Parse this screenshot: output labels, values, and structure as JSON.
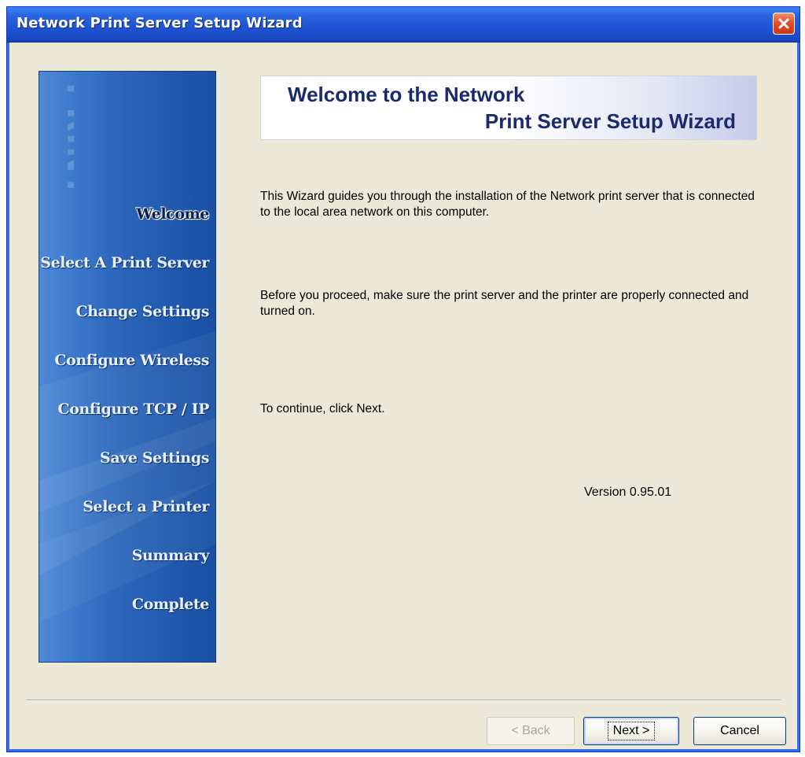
{
  "window": {
    "title": "Network Print Server Setup Wizard"
  },
  "sidebar": {
    "watermark_text": "PRINT",
    "steps": [
      {
        "label": "Welcome",
        "active": true
      },
      {
        "label": "Select A Print Server",
        "active": false
      },
      {
        "label": "Change Settings",
        "active": false
      },
      {
        "label": "Configure Wireless",
        "active": false
      },
      {
        "label": "Configure TCP / IP",
        "active": false
      },
      {
        "label": "Save Settings",
        "active": false
      },
      {
        "label": "Select a Printer",
        "active": false
      },
      {
        "label": "Summary",
        "active": false
      },
      {
        "label": "Complete",
        "active": false
      }
    ]
  },
  "banner": {
    "line1": "Welcome to the Network",
    "line2": "Print Server Setup Wizard"
  },
  "body": {
    "para1": "This Wizard guides you through the installation of the Network print server that is connected to the local area network on this computer.",
    "para2": "Before you proceed, make sure the print server and the printer are properly connected and turned on.",
    "para3": "To continue, click Next.",
    "version": "Version 0.95.01"
  },
  "buttons": {
    "back_label": "< Back",
    "next_label": "Next >",
    "cancel_label": "Cancel"
  },
  "colors": {
    "titlebar": "#1f55d4",
    "sidebar": "#2565c0",
    "banner_text": "#1a2a6c",
    "window_bg": "#ece9d8"
  }
}
